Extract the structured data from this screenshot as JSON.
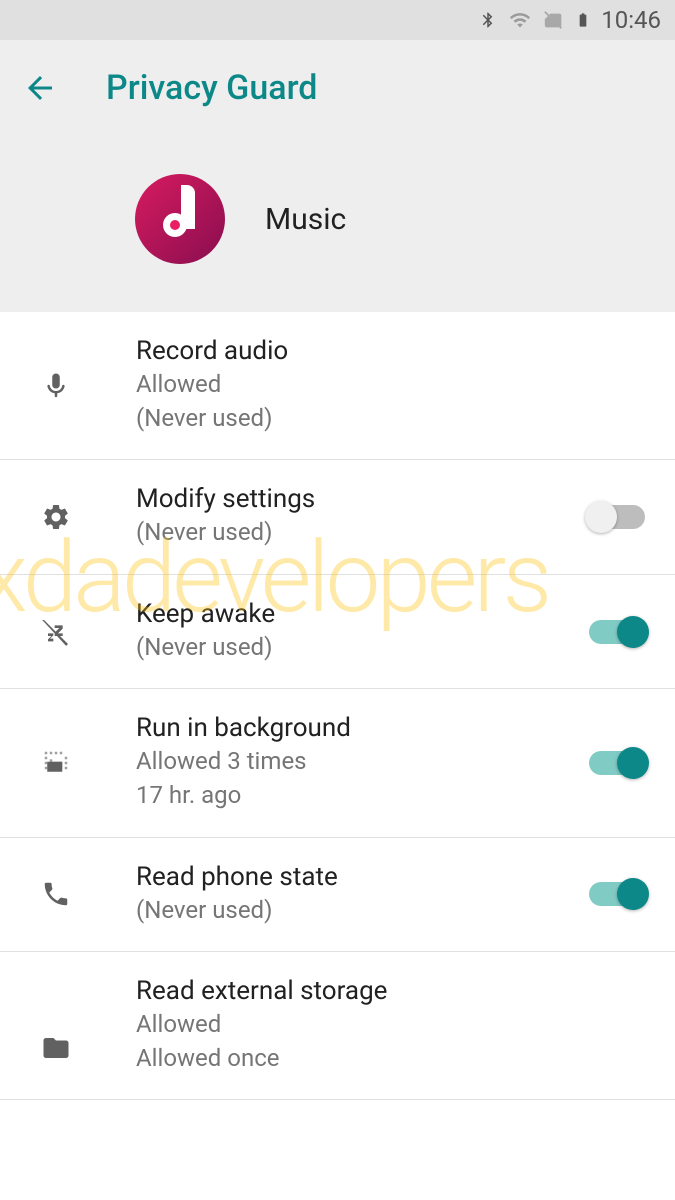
{
  "statusBar": {
    "time": "10:46"
  },
  "header": {
    "title": "Privacy Guard"
  },
  "app": {
    "name": "Music"
  },
  "permissions": [
    {
      "title": "Record audio",
      "line1": "Allowed",
      "line2": "(Never used)",
      "hasSwitch": false
    },
    {
      "title": "Modify settings",
      "line1": "(Never used)",
      "line2": "",
      "hasSwitch": true,
      "switchOn": false
    },
    {
      "title": "Keep awake",
      "line1": "(Never used)",
      "line2": "",
      "hasSwitch": true,
      "switchOn": true
    },
    {
      "title": "Run in background",
      "line1": "Allowed 3 times",
      "line2": "17 hr. ago",
      "hasSwitch": true,
      "switchOn": true
    },
    {
      "title": "Read phone state",
      "line1": "(Never used)",
      "line2": "",
      "hasSwitch": true,
      "switchOn": true
    },
    {
      "title": "Read external storage",
      "line1": "Allowed",
      "line2": "Allowed once",
      "hasSwitch": false
    }
  ],
  "watermark": "xdadevelopers"
}
